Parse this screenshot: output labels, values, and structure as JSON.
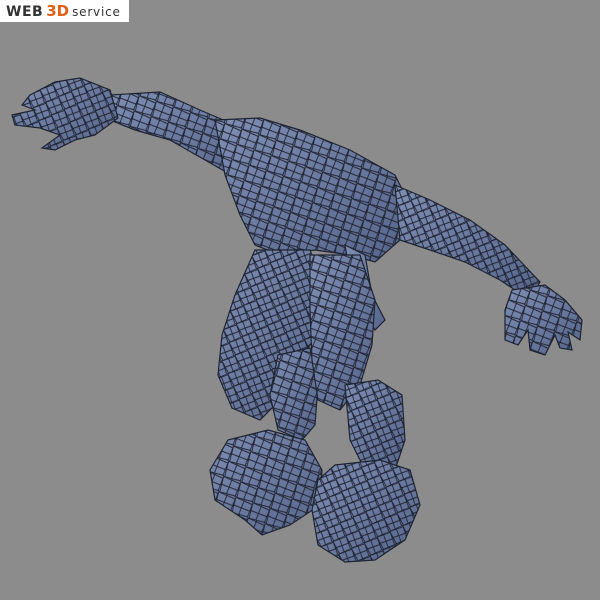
{
  "watermark": {
    "web": "WEB",
    "threed": "3D",
    "service": "service"
  },
  "colors": {
    "background": "#8c8c8c",
    "mesh_fill": "#6b7ba0",
    "mesh_wire": "#1f2433",
    "accent": "#e0601a"
  },
  "model": {
    "kind": "wireframe-humanoid-creature",
    "shading": "flat-blue-with-black-wireframe"
  }
}
